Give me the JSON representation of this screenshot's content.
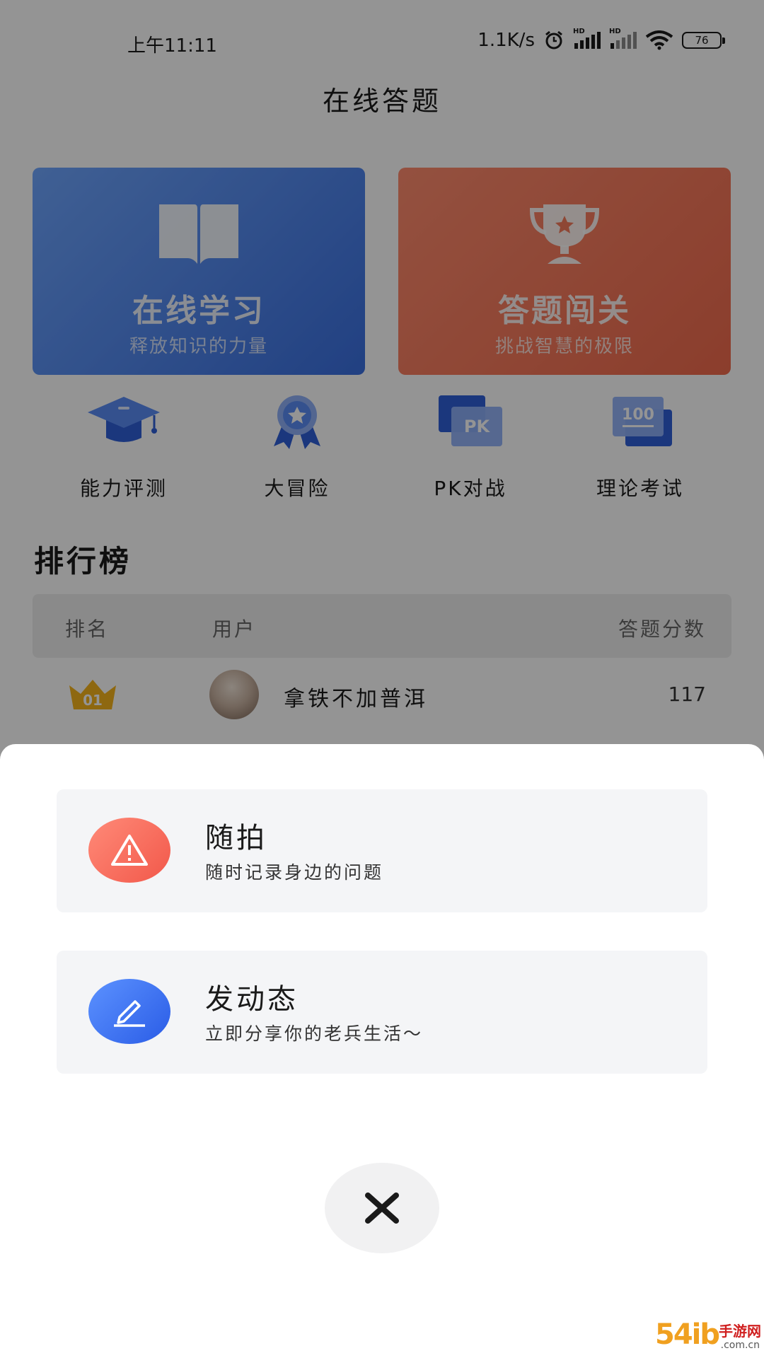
{
  "status_bar": {
    "time": "上午11:11",
    "net_speed": "1.1K/s",
    "battery": "76",
    "hd1": "HD",
    "hd2": "HD"
  },
  "app": {
    "title": "在线答题"
  },
  "feature_cards": [
    {
      "title": "在线学习",
      "subtitle": "释放知识的力量",
      "icon": "book-icon",
      "color": "#4a7ef0"
    },
    {
      "title": "答题闯关",
      "subtitle": "挑战智慧的极限",
      "icon": "trophy-icon",
      "color": "#f47a5c"
    }
  ],
  "quick_actions": [
    {
      "label": "能力评测",
      "icon": "graduation-cap-icon"
    },
    {
      "label": "大冒险",
      "icon": "medal-icon"
    },
    {
      "label": "PK对战",
      "icon": "pk-icon",
      "badge": "PK"
    },
    {
      "label": "理论考试",
      "icon": "exam-100-icon",
      "badge": "100"
    }
  ],
  "leaderboard": {
    "title": "排行榜",
    "columns": {
      "rank": "排名",
      "user": "用户",
      "score": "答题分数"
    },
    "rows": [
      {
        "rank": "01",
        "name": "拿铁不加普洱",
        "score": "117"
      }
    ]
  },
  "sheet": {
    "actions": [
      {
        "title": "随拍",
        "subtitle": "随时记录身边的问题",
        "icon": "warning-icon",
        "color": "#f5624f"
      },
      {
        "title": "发动态",
        "subtitle": "立即分享你的老兵生活～",
        "icon": "pencil-icon",
        "color": "#3466ea"
      }
    ],
    "close_icon": "close-icon"
  },
  "watermark": {
    "num": "54ib",
    "cn": "手游网",
    "domain": ".com.cn"
  }
}
